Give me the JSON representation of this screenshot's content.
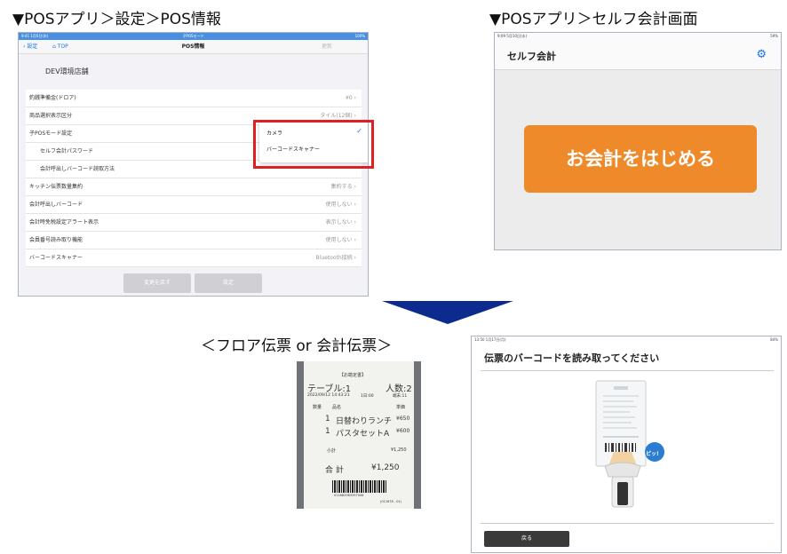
{
  "headings": {
    "pos_info": "▼POSアプリ＞設定＞POS情報",
    "self_checkout": "▼POSアプリ＞セルフ会計画面",
    "slip": "＜フロア伝票 or 会計伝票＞"
  },
  "pos_info_screen": {
    "status_left": "9:41  1月6日(木)",
    "status_center": "子POSモード",
    "status_right": "100%",
    "back_label": "設定",
    "top_label": "TOP",
    "title": "POS情報",
    "right_label": "更新",
    "store_name": "DEV環境店舗",
    "rows": [
      {
        "label": "釣銭準備金(ドロア)",
        "value": "¥0"
      },
      {
        "label": "商品選択表示区分",
        "value": "タイル(12個)"
      },
      {
        "label": "子POSモード設定",
        "value": ""
      },
      {
        "label": "セルフ会計パスワード",
        "value": ""
      },
      {
        "label": "会計呼出しバーコード読取方法",
        "value": ""
      },
      {
        "label": "キッチン伝票数量集約",
        "value": "集約する"
      },
      {
        "label": "会計呼出しバーコード",
        "value": "使用しない"
      },
      {
        "label": "会計時免税設定アラート表示",
        "value": "表示しない"
      },
      {
        "label": "会員番号読み取り機能",
        "value": "使用しない"
      },
      {
        "label": "バーコードスキャナー",
        "value": "Bluetooth接続"
      }
    ],
    "popup_options": [
      "カメラ",
      "バーコードスキャナー"
    ],
    "popup_selected": "カメラ",
    "buttons": {
      "revert": "変更を戻す",
      "set": "設定"
    }
  },
  "self_checkout_screen": {
    "status_left": "9:09  5月10日(水)",
    "status_right": "59%",
    "title": "セルフ会計",
    "start_button": "お会計をはじめる"
  },
  "receipt": {
    "header": "【お勘定書】",
    "table": "テーブル:1",
    "people": "人数:2",
    "datetime": "2022/09/12  14:43:21",
    "time_alt": "1日:00",
    "tax": "端末:11",
    "col_qty": "数量",
    "col_name": "品名",
    "col_price": "単価",
    "items": [
      {
        "qty": "1",
        "name": "日替わりランチ",
        "price": "¥650"
      },
      {
        "qty": "1",
        "name": "パスタセットA",
        "price": "¥600"
      }
    ],
    "subtotal_label": "小計",
    "subtotal": "¥1,250",
    "total_label": "合 計",
    "total": "¥1,250",
    "barcode_number": "011682983397006",
    "footer": "(011678 - 01)"
  },
  "scan_screen": {
    "status_left": "13:50  1月17日(月)",
    "status_right": "84%",
    "title": "伝票のバーコードを読み取ってください",
    "beep": "ピッ!",
    "back_button": "戻る"
  },
  "colors": {
    "accent_blue": "#1a73e8",
    "orange": "#ef8a2a",
    "highlight_red": "#e02020",
    "arrow_navy": "#0d2b8f"
  }
}
